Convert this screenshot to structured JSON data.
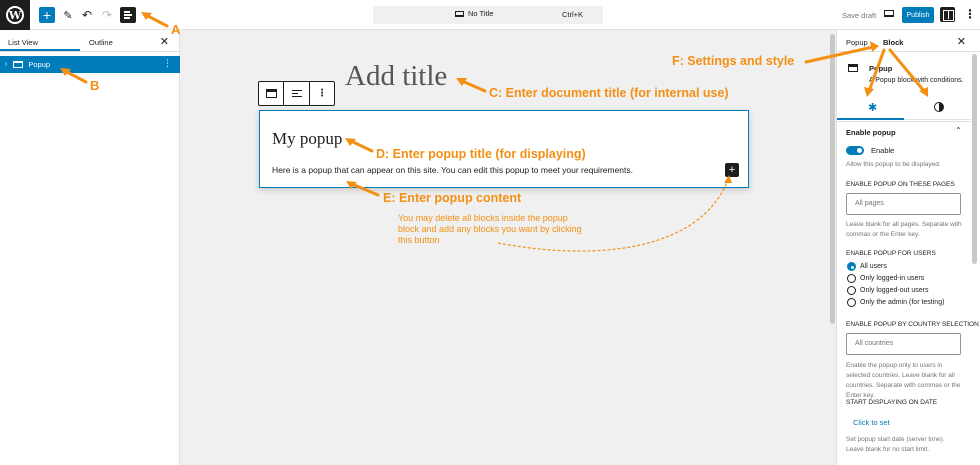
{
  "topbar": {
    "logo_letter": "W",
    "add_icon": "plus-icon",
    "undo_icon": "undo-icon",
    "redo_icon": "redo-icon",
    "command_bar_title": "No Title",
    "command_bar_shortcut": "Ctrl+K",
    "save_draft_label": "Save draft",
    "publish_label": "Publish"
  },
  "left_panel": {
    "tab_list_view": "List View",
    "tab_outline": "Outline",
    "close_glyph": "✕",
    "items": [
      {
        "label": "Popup"
      }
    ]
  },
  "canvas": {
    "title_placeholder": "Add title",
    "popup_title": "My popup",
    "popup_content": "Here is a popup that can appear on this site. You can edit this popup to meet your requirements."
  },
  "annotations": {
    "a": "A",
    "b": "B",
    "c": "C: Enter document title (for internal use)",
    "d": "D: Enter popup title (for displaying)",
    "e": "E: Enter popup content",
    "f": "F: Settings and style",
    "note": "You may delete all blocks inside the popup block and add any blocks you want by clicking this button"
  },
  "right_panel": {
    "tab_popup": "Popup",
    "tab_block": "Block",
    "close_glyph": "✕",
    "block_name": "Popup",
    "block_description": "A Popup block with conditions.",
    "section_title": "Enable popup",
    "enable_label": "Enable",
    "enable_help": "Allow this popup to be displayed.",
    "pages_label": "ENABLE POPUP ON THESE PAGES",
    "pages_placeholder": "All pages",
    "pages_help": "Leave blank for all pages. Separate with commas or the Enter key.",
    "users_label": "ENABLE POPUP FOR USERS",
    "user_options": [
      "All users",
      "Only logged-in users",
      "Only logged-out users",
      "Only the admin (for testing)"
    ],
    "user_selected": "All users",
    "country_label": "ENABLE POPUP BY COUNTRY SELECTION",
    "country_placeholder": "All countries",
    "country_help": "Enable the popup only to users in selected countries. Leave blank for all countries. Separate with commas or the Enter key.",
    "start_label": "START DISPLAYING ON DATE",
    "start_link": "Click to set",
    "start_help": "Set popup start date (server time). Leave blank for no start limit."
  },
  "colors": {
    "accent": "#007cba",
    "annotation": "#f39014"
  }
}
